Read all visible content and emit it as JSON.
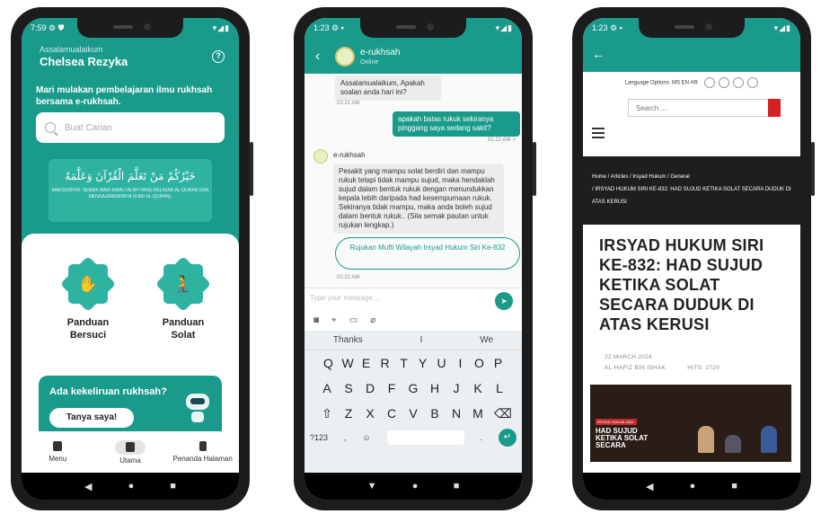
{
  "phone1": {
    "status": {
      "time": "7:59",
      "icons": "⚙ ⛊",
      "signal": "▾◢▮"
    },
    "greeting": "Assalamualaikum",
    "user_name": "Chelsea Rezyka",
    "tagline": "Mari mulakan pembelajaran ilmu rukhsah bersama e-rukhsah.",
    "search_placeholder": "Buat Carian",
    "banner": {
      "arabic": "خَيْرُكُمْ مَنْ تَعَلَّمَ الْقُرْآنَ وَعَلَّمَهُ",
      "sub": "MAKSUDNYA: SEBAIK-BAIK KAMU IALAH YANG BELAJAR AL-QURAN DAN MENGAJARKANNYA (ILMU AL-QURAN)."
    },
    "tiles": [
      {
        "label1": "Panduan",
        "label2": "Bersuci"
      },
      {
        "label1": "Panduan",
        "label2": "Solat"
      }
    ],
    "cta": {
      "question": "Ada kekeliruan rukhsah?",
      "button": "Tanya saya!"
    },
    "tabs": [
      "Menu",
      "Utama",
      "Penanda Halaman"
    ]
  },
  "phone2": {
    "status": {
      "time": "1:23",
      "icons": "⚙ ▪",
      "signal": "▾◢▮"
    },
    "chat_name": "e-rukhsah",
    "chat_status": "Online",
    "msg1": "Assalamualaikum, Apakah soalan anda hari ini?",
    "time1": "01:21 AM",
    "msg2": "apakah batas rukuk sekiranya pinggang saya sedang sakit?",
    "time2": "01:22 AM ✓",
    "sender": "e-rukhsah",
    "msg3": "Pesakit yang mampu solat berdiri dan mampu rukuk tetapi tidak mampu sujud, maka hendaklah sujud dalam bentuk rukuk dengan menundukkan kepala lebih daripada had kesempurnaan rukuk. Sekiranya tidak mampu, maka anda boleh sujud dalam bentuk rukuk.. (Sila semak pautan untuk rujukan lengkap.)",
    "link": "Rujukan Mufti Wilayah Irsyad Hukum Siri Ke-832",
    "time3": "01:22 AM",
    "compose_placeholder": "Type your message...",
    "suggestions": [
      "Thanks",
      "I",
      "We"
    ],
    "keys_row1": [
      "Q",
      "W",
      "E",
      "R",
      "T",
      "Y",
      "U",
      "I",
      "O",
      "P"
    ],
    "keys_row2": [
      "A",
      "S",
      "D",
      "F",
      "G",
      "H",
      "J",
      "K",
      "L"
    ],
    "keys_row3": [
      "⇧",
      "Z",
      "X",
      "C",
      "V",
      "B",
      "N",
      "M",
      "⌫"
    ],
    "key_numbers": "?123",
    "key_comma": ",",
    "key_period": "."
  },
  "phone3": {
    "status": {
      "time": "1:23",
      "icons": "⚙ ▪",
      "signal": "▾◢▮"
    },
    "language_label": "Language Options:  MS  EN  AR",
    "search_placeholder": "Search ...",
    "breadcrumb1": "Home  /  Articles  /  Irsyad Hukum  /  General",
    "breadcrumb2": "/  IRSYAD HUKUM SIRI KE-832: HAD SUJUD KETIKA SOLAT SECARA DUDUK DI ATAS KERUSI",
    "title": "IRSYAD HUKUM SIRI KE-832: HAD SUJUD KETIKA SOLAT SECARA DUDUK DI ATAS KERUSI",
    "date": "22 MARCH 2024",
    "author": "AL-HAFIZ BIN ISHAK",
    "hits": "HITS: 2720",
    "image_badge": "IRSYAD HUKUM #832:",
    "image_overlay": "HAD SUJUD KETIKA SOLAT SECARA"
  }
}
